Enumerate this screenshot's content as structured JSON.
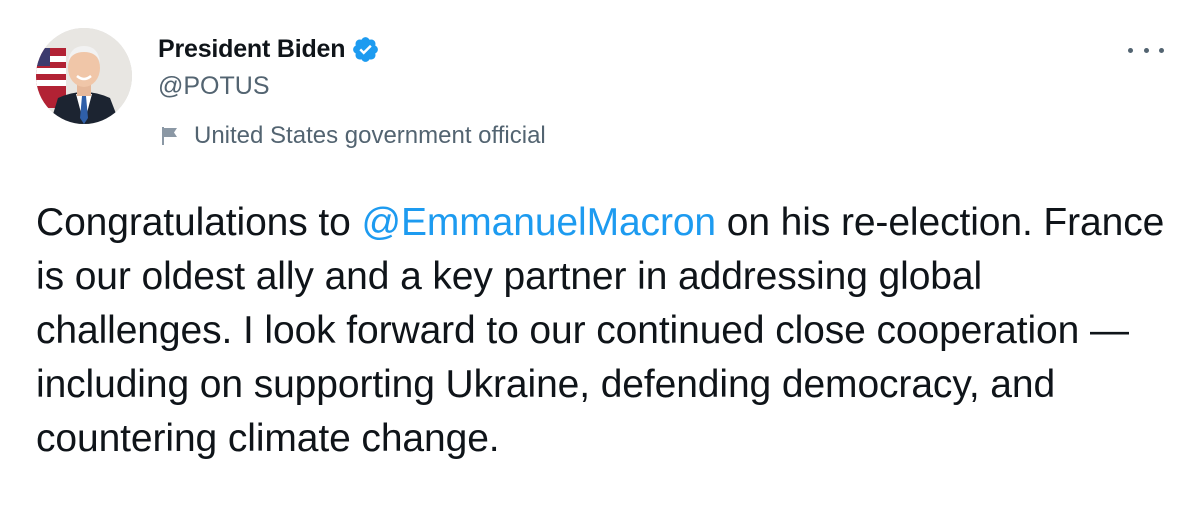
{
  "tweet": {
    "author": {
      "display_name": "President Biden",
      "handle": "@POTUS",
      "verified": true,
      "label": "United States government official",
      "avatar_icon": "portrait-avatar",
      "verified_icon": "verified-badge-icon",
      "label_icon": "flag-icon"
    },
    "more_icon": "more-options-icon",
    "text": {
      "part1": "Congratulations to ",
      "mention": "@EmmanuelMacron",
      "part2": " on his re-election. France is our oldest ally and a key partner in addressing global challenges. I look forward to our continued close cooperation — including on supporting Ukraine, defending democracy, and countering climate change."
    }
  },
  "colors": {
    "text_primary": "#0f1419",
    "text_secondary": "#536471",
    "link": "#1d9bf0",
    "verified": "#1d9bf0"
  }
}
